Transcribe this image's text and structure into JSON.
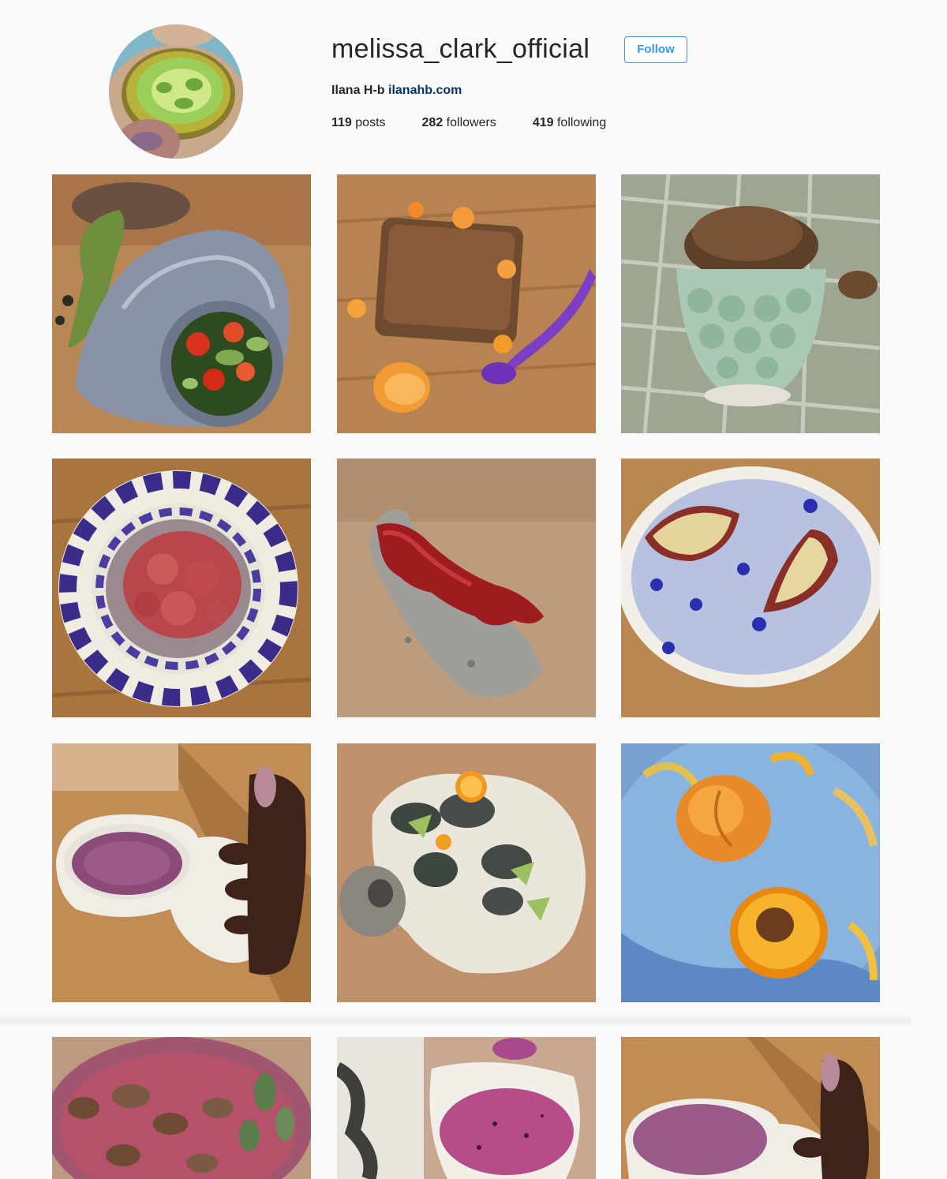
{
  "profile": {
    "username": "melissa_clark_official",
    "follow_label": "Follow",
    "full_name": "Ilana H-b",
    "website": "ilanahb.com",
    "avatar_icon": "green-tomato-avatar"
  },
  "stats": {
    "posts_count": "119",
    "posts_label": "posts",
    "followers_count": "282",
    "followers_label": "followers",
    "following_count": "419",
    "following_label": "following"
  },
  "colors": {
    "accent": "#3897f0",
    "background": "#fafafa",
    "text": "#262626",
    "link": "#003569"
  }
}
